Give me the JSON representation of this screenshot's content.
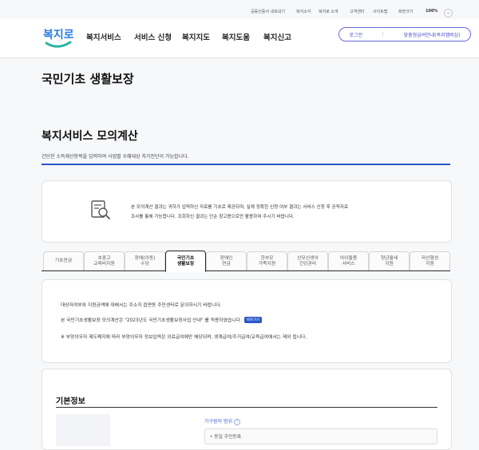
{
  "utility": {
    "items": [
      "공동인증서 내보내기",
      "복지소식",
      "복지로 소개",
      "고객센터",
      "사이트맵",
      "화면크기",
      "100%"
    ]
  },
  "header": {
    "logo_text": "복지로",
    "nav": [
      "복지서비스",
      "서비스 신청",
      "복지지도",
      "복지도움",
      "복지신고"
    ],
    "login_label": "로그인",
    "custom_label": "맞춤형급여안내(복지멤버십)"
  },
  "page": {
    "title": "국민기초 생활보장"
  },
  "calc": {
    "title": "복지서비스 모의계산",
    "desc": "간단한 소득재산항목을 입력하여 사업별 수혜대상 자가진단이 가능합니다.",
    "notice_line1": "본 모의계산 결과는 귀하가 입력하신 자료를 기초로 제공되며, 실제 정확한 신청 여부 결과는 서비스 신청 후 공적자료",
    "notice_line2": "조사를 통해 가능합니다. 조회하신 결과는 단순 참고용으로만 활용하여 주시기 바랍니다."
  },
  "tabs": [
    {
      "line1": "기초연금",
      "line2": ""
    },
    {
      "line1": "초중고",
      "line2": "교육비지원"
    },
    {
      "line1": "장애(아동)",
      "line2": "수당"
    },
    {
      "line1": "국민기초",
      "line2": "생활보장"
    },
    {
      "line1": "장애인",
      "line2": "연금"
    },
    {
      "line1": "한부모",
      "line2": "가족지원"
    },
    {
      "line1": "산모신생아",
      "line2": "건강관리"
    },
    {
      "line1": "아이돌봄",
      "line2": "서비스"
    },
    {
      "line1": "청년월세",
      "line2": "지원"
    },
    {
      "line1": "자산형성",
      "line2": "지원"
    }
  ],
  "info": {
    "line1": "대상자여부와 지원금액에 대해서는 주소지 읍면동 주민센터로 문의하시기 바랍니다.",
    "line2": "본 국민기초생활보장 모의계산은 \"2023년도 국민기초생활보장사업 안내\" 를 적용하였습니다.",
    "badge": "바로가기",
    "line3": "※ 부양의무자 제도폐지에 따라 부양의무자 정보입력은 의료급여에만 해당되며, 생계급여/주거급여/교육급여에서는 제외 됩니다."
  },
  "basic": {
    "title": "기본정보",
    "household_label": "가구원의 범위",
    "field_value": "• 동일 주민등록"
  },
  "colors": {
    "accent": "#2a55c8",
    "brand_purple": "#4b4bc8"
  }
}
